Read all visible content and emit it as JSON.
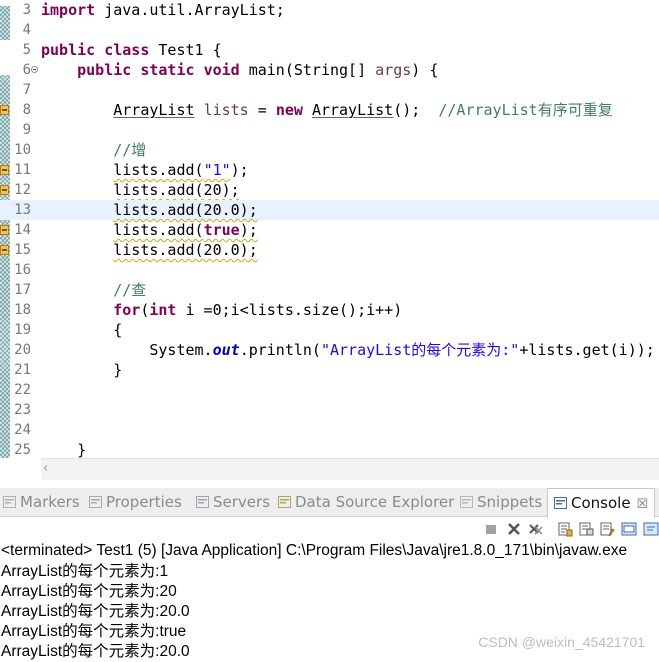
{
  "editor": {
    "current_line": "13",
    "lines": [
      {
        "n": "3",
        "tokens": [
          {
            "t": "import",
            "c": "kw"
          },
          {
            "t": " java.util.ArrayList;",
            "c": "pl"
          }
        ]
      },
      {
        "n": "4",
        "tokens": []
      },
      {
        "n": "5",
        "tokens": [
          {
            "t": "public",
            "c": "kw"
          },
          {
            "t": " ",
            "c": "pl"
          },
          {
            "t": "class",
            "c": "kw"
          },
          {
            "t": " Test1 {",
            "c": "pl"
          }
        ]
      },
      {
        "n": "6",
        "fold": true,
        "tokens": [
          {
            "t": "    ",
            "c": "pl"
          },
          {
            "t": "public",
            "c": "kw"
          },
          {
            "t": " ",
            "c": "pl"
          },
          {
            "t": "static",
            "c": "kw"
          },
          {
            "t": " ",
            "c": "pl"
          },
          {
            "t": "void",
            "c": "kw"
          },
          {
            "t": " main(String[] ",
            "c": "pl"
          },
          {
            "t": "args",
            "c": "var"
          },
          {
            "t": ") {",
            "c": "pl"
          }
        ]
      },
      {
        "n": "7",
        "tokens": []
      },
      {
        "n": "8",
        "marker": true,
        "tokens": [
          {
            "t": "        ",
            "c": "pl"
          },
          {
            "t": "ArrayList",
            "c": "pl uw"
          },
          {
            "t": " ",
            "c": "pl"
          },
          {
            "t": "lists",
            "c": "var"
          },
          {
            "t": " = ",
            "c": "pl"
          },
          {
            "t": "new",
            "c": "kw"
          },
          {
            "t": " ",
            "c": "pl"
          },
          {
            "t": "ArrayList",
            "c": "pl uw"
          },
          {
            "t": "();  ",
            "c": "pl"
          },
          {
            "t": "//ArrayList有序可重复",
            "c": "cm"
          }
        ]
      },
      {
        "n": "9",
        "tokens": []
      },
      {
        "n": "10",
        "tokens": [
          {
            "t": "        ",
            "c": "pl"
          },
          {
            "t": "//增",
            "c": "cm"
          }
        ]
      },
      {
        "n": "11",
        "marker": true,
        "tokens": [
          {
            "t": "        ",
            "c": "pl"
          },
          {
            "t": "lists.add(",
            "c": "pl wv"
          },
          {
            "t": "\"1\"",
            "c": "st wv"
          },
          {
            "t": ");",
            "c": "pl"
          }
        ]
      },
      {
        "n": "12",
        "marker": true,
        "tokens": [
          {
            "t": "        ",
            "c": "pl"
          },
          {
            "t": "lists.add(20);",
            "c": "pl wv"
          }
        ]
      },
      {
        "n": "13",
        "marker": true,
        "tokens": [
          {
            "t": "        ",
            "c": "pl"
          },
          {
            "t": "lists.add(20.0);",
            "c": "pl wv"
          }
        ]
      },
      {
        "n": "14",
        "marker": true,
        "tokens": [
          {
            "t": "        ",
            "c": "pl"
          },
          {
            "t": "lists.add(",
            "c": "pl wv"
          },
          {
            "t": "true",
            "c": "kw wv"
          },
          {
            "t": ");",
            "c": "pl wv"
          }
        ]
      },
      {
        "n": "15",
        "marker": true,
        "tokens": [
          {
            "t": "        ",
            "c": "pl"
          },
          {
            "t": "lists.add(20.0);",
            "c": "pl wv"
          }
        ]
      },
      {
        "n": "16",
        "tokens": []
      },
      {
        "n": "17",
        "tokens": [
          {
            "t": "        ",
            "c": "pl"
          },
          {
            "t": "//查",
            "c": "cm"
          }
        ]
      },
      {
        "n": "18",
        "tokens": [
          {
            "t": "        ",
            "c": "pl"
          },
          {
            "t": "for",
            "c": "kw"
          },
          {
            "t": "(",
            "c": "pl"
          },
          {
            "t": "int",
            "c": "kw"
          },
          {
            "t": " i =0;i<lists.size();i++)",
            "c": "pl"
          }
        ]
      },
      {
        "n": "19",
        "tokens": [
          {
            "t": "        {",
            "c": "pl"
          }
        ]
      },
      {
        "n": "20",
        "tokens": [
          {
            "t": "            System.",
            "c": "pl"
          },
          {
            "t": "out",
            "c": "fld"
          },
          {
            "t": ".println(",
            "c": "pl"
          },
          {
            "t": "\"ArrayList的每个元素为:\"",
            "c": "st"
          },
          {
            "t": "+lists.get(i));",
            "c": "pl"
          }
        ]
      },
      {
        "n": "21",
        "tokens": [
          {
            "t": "        }",
            "c": "pl"
          }
        ]
      },
      {
        "n": "22",
        "tokens": []
      },
      {
        "n": "23",
        "tokens": []
      },
      {
        "n": "24",
        "tokens": []
      },
      {
        "n": "25",
        "tokens": [
          {
            "t": "    }",
            "c": "pl"
          }
        ]
      }
    ]
  },
  "views": {
    "tabs": [
      {
        "label": "Markers",
        "icon": "markers-icon",
        "active": false
      },
      {
        "label": "Properties",
        "icon": "properties-icon",
        "active": false
      },
      {
        "label": "Servers",
        "icon": "servers-icon",
        "active": false
      },
      {
        "label": "Data Source Explorer",
        "icon": "data-source-icon",
        "active": false
      },
      {
        "label": "Snippets",
        "icon": "snippets-icon",
        "active": false
      },
      {
        "label": "Console",
        "icon": "console-icon",
        "active": true,
        "close": "☒"
      }
    ],
    "terminated": "<terminated> Test1 (5) [Java Application] C:\\Program Files\\Java\\jre1.8.0_171\\bin\\javaw.exe",
    "output": [
      "ArrayList的每个元素为:1",
      "ArrayList的每个元素为:20",
      "ArrayList的每个元素为:20.0",
      "ArrayList的每个元素为:true",
      "ArrayList的每个元素为:20.0"
    ],
    "toolbar_icons": [
      "terminate-icon",
      "remove-launch-icon",
      "remove-all-icon",
      "scroll-lock-icon",
      "clear-console-icon",
      "pin-console-icon",
      "display-console-icon",
      "open-console-icon"
    ]
  },
  "watermark": "CSDN @weixin_45421701",
  "colors": {
    "keyword": "#7f0055",
    "comment": "#3f7f5f",
    "string": "#2a00ff",
    "current_line": "#e8f2fe"
  }
}
